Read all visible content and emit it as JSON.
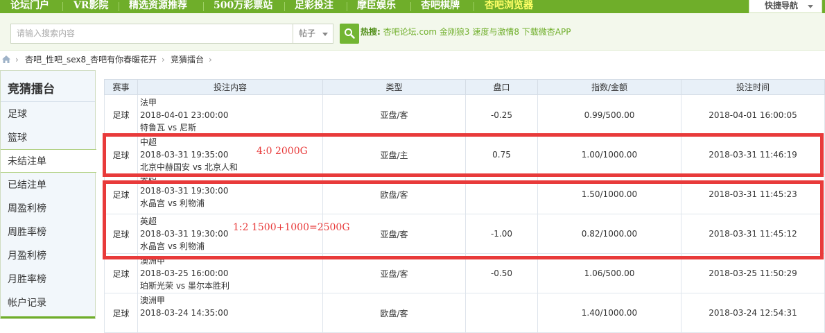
{
  "topnav": {
    "items": [
      "论坛门户",
      "VR影院",
      "精选资源推荐",
      "500万彩票站",
      "足彩投注",
      "摩臣娱乐",
      "杏吧棋牌",
      "杏吧浏览器"
    ],
    "quick_nav": "快捷导航",
    "colors": {
      "bar": "#6fae2a",
      "highlight": "#ffff66"
    }
  },
  "search": {
    "placeholder": "请输入搜索内容",
    "scope": "帖子",
    "hot_label": "热搜:",
    "hot_terms": "杏吧论坛.com 金刚狼3 速度与激情8 下载微杏APP"
  },
  "breadcrumb": {
    "items": [
      "杏吧_性吧_sex8_杏吧有你春暖花开",
      "竞猜擂台"
    ]
  },
  "sidebar": {
    "title": "竞猜擂台",
    "items": [
      "足球",
      "篮球",
      "未结注单",
      "已结注单",
      "周盈利榜",
      "周胜率榜",
      "月盈利榜",
      "月胜率榜",
      "帐户记录"
    ],
    "active_item": "未结注单"
  },
  "table": {
    "headers": [
      "赛事",
      "投注内容",
      "类型",
      "盘口",
      "指数/金额",
      "投注时间"
    ],
    "rows": [
      {
        "sport": "足球",
        "league": "法甲",
        "match_time": "2018-04-01 23:00:00",
        "teams": "特鲁瓦 vs 尼斯",
        "type": "亚盘/客",
        "handicap": "-0.25",
        "odds_amount": "0.99/500.00",
        "bet_time": "2018-04-01 16:00:05"
      },
      {
        "sport": "足球",
        "league": "中超",
        "match_time": "2018-03-31 19:35:00",
        "teams": "北京中赫国安 vs 北京人和",
        "type": "亚盘/主",
        "handicap": "0.75",
        "odds_amount": "1.00/1000.00",
        "bet_time": "2018-03-31 11:46:19"
      },
      {
        "sport": "足球",
        "league": "英超",
        "match_time": "2018-03-31 19:30:00",
        "teams": "水晶宫 vs 利物浦",
        "type": "欧盘/客",
        "handicap": "",
        "odds_amount": "1.50/1000.00",
        "bet_time": "2018-03-31 11:45:23"
      },
      {
        "sport": "足球",
        "league": "英超",
        "match_time": "2018-03-31 19:30:00",
        "teams": "水晶宫 vs 利物浦",
        "type": "亚盘/客",
        "handicap": "-1.00",
        "odds_amount": "0.82/1000.00",
        "bet_time": "2018-03-31 11:45:12"
      },
      {
        "sport": "足球",
        "league": "澳洲甲",
        "match_time": "2018-03-25 16:00:00",
        "teams": "珀斯光荣 vs 墨尔本胜利",
        "type": "亚盘/客",
        "handicap": "-0.50",
        "odds_amount": "1.06/500.00",
        "bet_time": "2018-03-25 11:50:29"
      },
      {
        "sport": "足球",
        "league": "澳洲甲",
        "match_time": "2018-03-24 14:35:00",
        "teams": "",
        "type": "欧盘/客",
        "handicap": "",
        "odds_amount": "1.40/1000.00",
        "bet_time": "2018-03-24 12:54:31"
      }
    ]
  },
  "annotations": {
    "note1": "4:0  2000G",
    "note2": "1:2  1500+1000=2500G",
    "color": "#e83a3a"
  }
}
